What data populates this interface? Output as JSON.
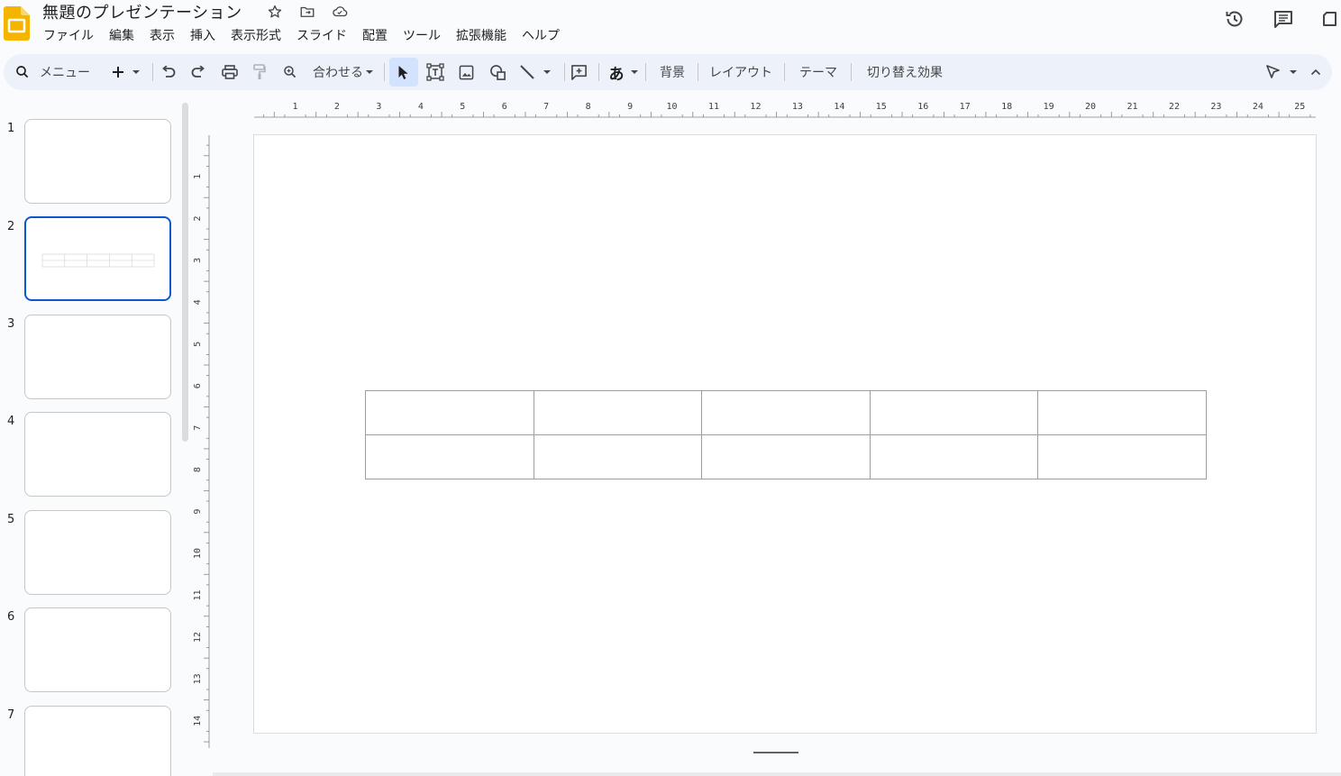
{
  "app": {
    "title": "無題のプレゼンテーション",
    "brand_color": "#f4b400"
  },
  "menu": [
    "ファイル",
    "編集",
    "表示",
    "挿入",
    "表示形式",
    "スライド",
    "配置",
    "ツール",
    "拡張機能",
    "ヘルプ"
  ],
  "toolbar": {
    "search_label": "メニュー",
    "zoom_label": "合わせる",
    "input_tool_label": "あ",
    "background_label": "背景",
    "layout_label": "レイアウト",
    "theme_label": "テーマ",
    "transition_label": "切り替え効果"
  },
  "filmstrip": {
    "slides": [
      {
        "number": "1",
        "active": false
      },
      {
        "number": "2",
        "active": true
      },
      {
        "number": "3",
        "active": false
      },
      {
        "number": "4",
        "active": false
      },
      {
        "number": "5",
        "active": false
      },
      {
        "number": "6",
        "active": false
      },
      {
        "number": "7",
        "active": false
      }
    ]
  },
  "rulers": {
    "horizontal_labels": [
      "1",
      "2",
      "3",
      "4",
      "5",
      "6",
      "7",
      "8",
      "9",
      "10",
      "11",
      "12",
      "13",
      "14",
      "15",
      "16",
      "17",
      "18",
      "19",
      "20",
      "21",
      "22",
      "23",
      "24",
      "25"
    ],
    "vertical_labels": [
      "1",
      "2",
      "3",
      "4",
      "5",
      "6",
      "7",
      "8",
      "9",
      "10",
      "11",
      "12",
      "13",
      "14"
    ]
  },
  "slide": {
    "table": {
      "rows": 2,
      "cols": 5
    }
  },
  "colors": {
    "accent": "#0b57d0",
    "toolbar_bg": "#edf2fa",
    "selected_tool_bg": "#d3e3fd"
  }
}
